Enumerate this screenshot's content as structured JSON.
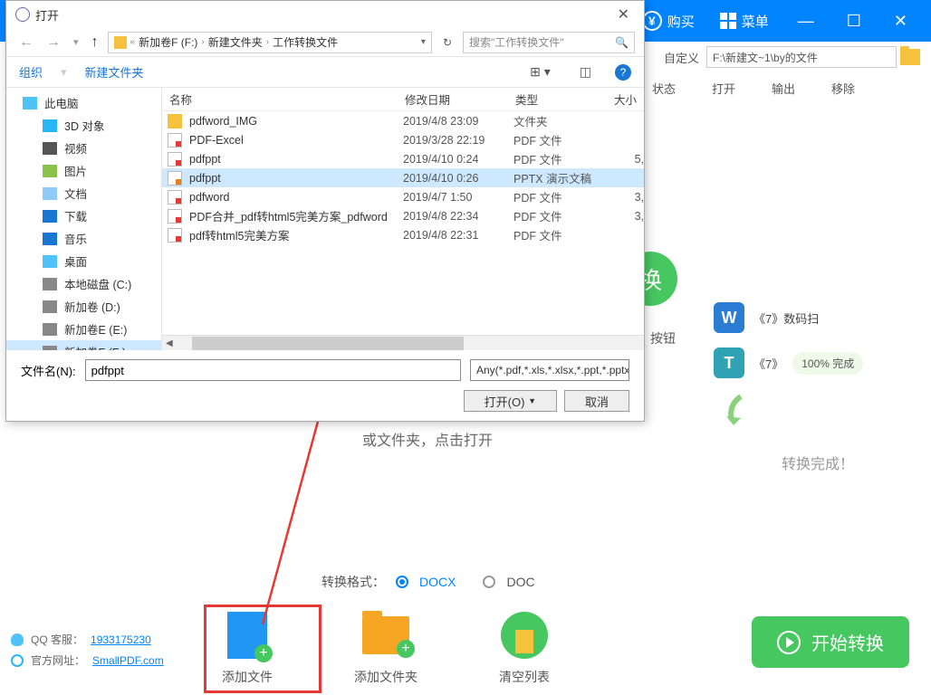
{
  "app": {
    "buy": "购买",
    "menu": "菜单",
    "customize": "自定义",
    "output_path": "F:\\新建文~1\\by的文件",
    "cols": {
      "status": "状态",
      "open": "打开",
      "output": "输出",
      "remove": "移除"
    },
    "convert_btn": "换",
    "result_items": [
      {
        "icon": "W",
        "name": "《7》数码扫",
        "cls": "word"
      },
      {
        "icon": "T",
        "name": "《7》",
        "cls": "text",
        "progress": "100% 完成"
      }
    ],
    "complete": "转换完成！",
    "drop_hint_line": "或文件夹，点击打开",
    "format_label": "转换格式：",
    "format_docx": "DOCX",
    "format_doc": "DOC",
    "actions": {
      "add_file": "添加文件",
      "add_folder": "添加文件夹",
      "clear": "清空列表"
    },
    "start": "开始转换",
    "qq_label": "QQ 客服：",
    "qq_link": "1933175230",
    "site_label": "官方网址：",
    "site_link": "SmallPDF.com"
  },
  "dialog": {
    "title": "打开",
    "breadcrumb": [
      "新加卷F (F:)",
      "新建文件夹",
      "工作转换文件"
    ],
    "search_ph": "搜索\"工作转换文件\"",
    "organize": "组织",
    "new_folder": "新建文件夹",
    "tree": [
      {
        "label": "此电脑",
        "ic": "pc",
        "indent": 18
      },
      {
        "label": "3D 对象",
        "ic": "cube",
        "indent": 40
      },
      {
        "label": "视频",
        "ic": "vid",
        "indent": 40
      },
      {
        "label": "图片",
        "ic": "img",
        "indent": 40
      },
      {
        "label": "文档",
        "ic": "doc",
        "indent": 40
      },
      {
        "label": "下载",
        "ic": "dl",
        "indent": 40
      },
      {
        "label": "音乐",
        "ic": "mus",
        "indent": 40
      },
      {
        "label": "桌面",
        "ic": "desk",
        "indent": 40
      },
      {
        "label": "本地磁盘 (C:)",
        "ic": "disk",
        "indent": 40
      },
      {
        "label": "新加卷 (D:)",
        "ic": "disk",
        "indent": 40
      },
      {
        "label": "新加卷E (E:)",
        "ic": "disk",
        "indent": 40
      },
      {
        "label": "新加卷F (F:)",
        "ic": "disk",
        "indent": 40,
        "sel": true
      }
    ],
    "cols": {
      "name": "名称",
      "date": "修改日期",
      "type": "类型",
      "size": "大小"
    },
    "files": [
      {
        "ic": "folder",
        "name": "pdfword_IMG",
        "date": "2019/4/8 23:09",
        "type": "文件夹",
        "size": ""
      },
      {
        "ic": "pdf",
        "name": "PDF-Excel",
        "date": "2019/3/28 22:19",
        "type": "PDF 文件",
        "size": ""
      },
      {
        "ic": "pdf",
        "name": "pdfppt",
        "date": "2019/4/10 0:24",
        "type": "PDF 文件",
        "size": "5,"
      },
      {
        "ic": "pptx",
        "name": "pdfppt",
        "date": "2019/4/10 0:26",
        "type": "PPTX 演示文稿",
        "size": "",
        "sel": true
      },
      {
        "ic": "pdf",
        "name": "pdfword",
        "date": "2019/4/7 1:50",
        "type": "PDF 文件",
        "size": "3,"
      },
      {
        "ic": "pdf",
        "name": "PDF合并_pdf转html5完美方案_pdfword",
        "date": "2019/4/8 22:34",
        "type": "PDF 文件",
        "size": "3,"
      },
      {
        "ic": "pdf",
        "name": "pdf转html5完美方案",
        "date": "2019/4/8 22:31",
        "type": "PDF 文件",
        "size": ""
      }
    ],
    "fname_label": "文件名(N):",
    "fname_value": "pdfppt",
    "filter": "Any(*.pdf,*.xls,*.xlsx,*.ppt,*.pptx)",
    "open_btn": "打开(O)",
    "cancel_btn": "取消",
    "drag_hint": "按钮"
  }
}
